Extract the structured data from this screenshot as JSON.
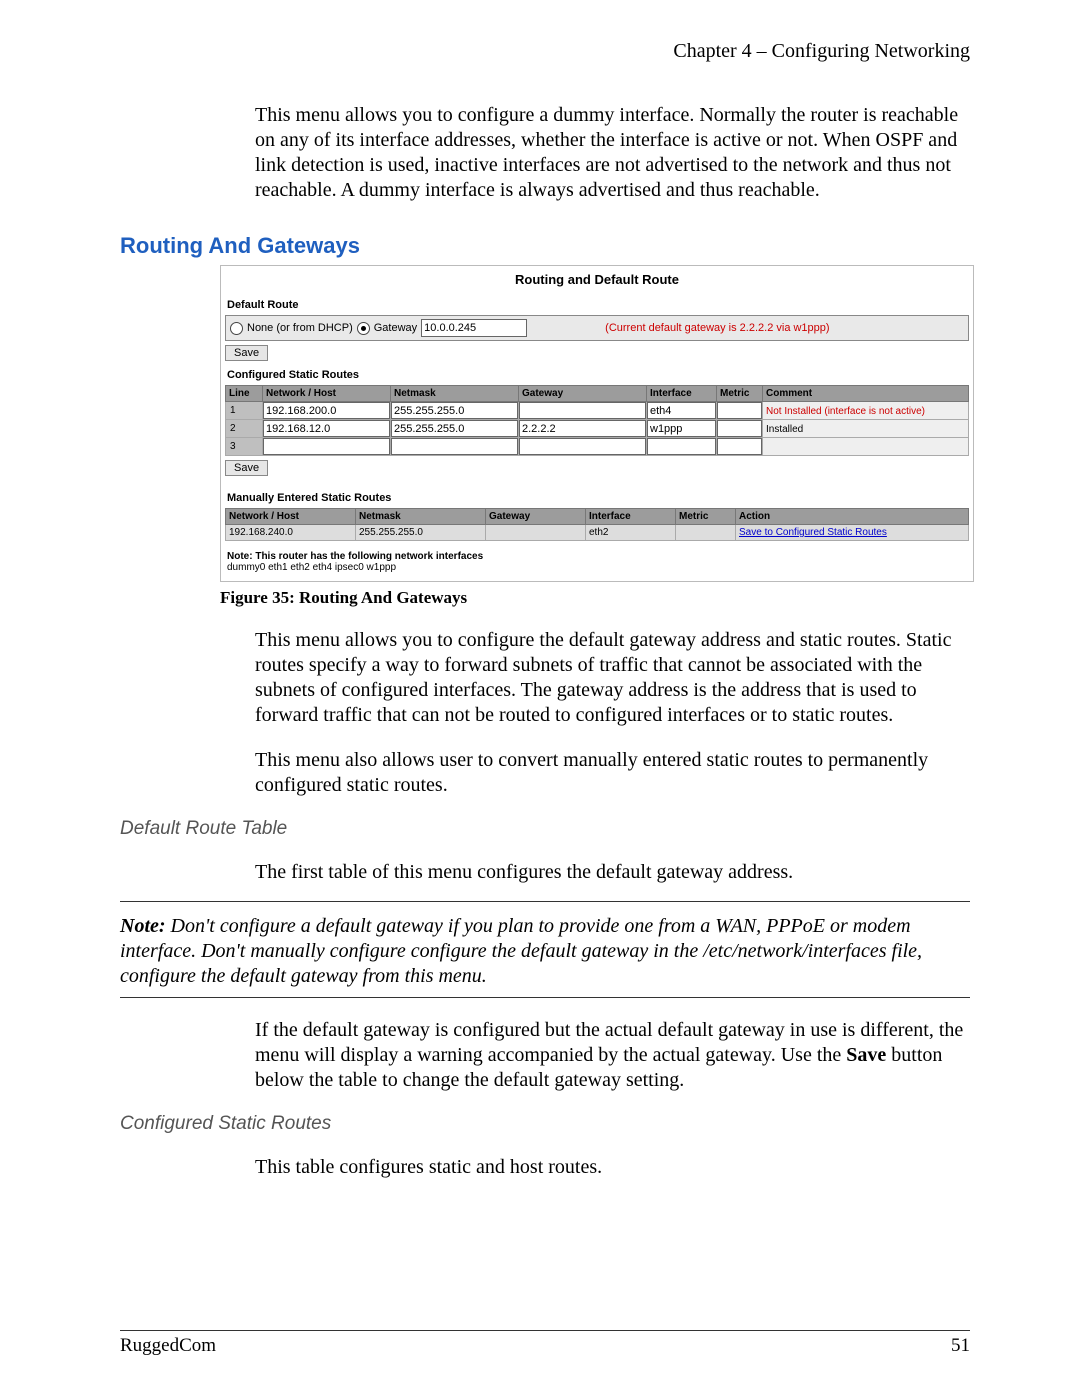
{
  "header": {
    "chapter": "Chapter 4 – Configuring Networking"
  },
  "intro_para": "This menu allows you to configure a dummy interface.  Normally the router is reachable on any of its interface addresses, whether the interface is active or not.  When OSPF and link detection is used, inactive interfaces are not advertised to the network and thus not reachable.  A dummy interface is always advertised and thus reachable.",
  "section_title": "Routing And Gateways",
  "panel": {
    "title": "Routing and Default Route",
    "default_route_label": "Default Route",
    "radio_none_label": "None (or from DHCP)",
    "radio_gateway_label": "Gateway",
    "gateway_value": "10.0.0.245",
    "current_default_text": "(Current default gateway is 2.2.2.2 via w1ppp)",
    "save_label": "Save",
    "configured_label": "Configured Static Routes",
    "cols": {
      "line": "Line",
      "network": "Network / Host",
      "netmask": "Netmask",
      "gateway": "Gateway",
      "interface": "Interface",
      "metric": "Metric",
      "comment": "Comment"
    },
    "rows": [
      {
        "line": "1",
        "network": "192.168.200.0",
        "netmask": "255.255.255.0",
        "gateway": "",
        "interface": "eth4",
        "metric": "",
        "comment": "Not Installed (interface is not active)",
        "comment_red": true
      },
      {
        "line": "2",
        "network": "192.168.12.0",
        "netmask": "255.255.255.0",
        "gateway": "2.2.2.2",
        "interface": "w1ppp",
        "metric": "",
        "comment": "Installed",
        "comment_red": false
      },
      {
        "line": "3",
        "network": "",
        "netmask": "",
        "gateway": "",
        "interface": "",
        "metric": "",
        "comment": "",
        "comment_red": false
      }
    ],
    "save2_label": "Save",
    "manual_label": "Manually Entered Static Routes",
    "mcols": {
      "network": "Network / Host",
      "netmask": "Netmask",
      "gateway": "Gateway",
      "interface": "Interface",
      "metric": "Metric",
      "action": "Action"
    },
    "mrow": {
      "network": "192.168.240.0",
      "netmask": "255.255.255.0",
      "gateway": "",
      "interface": "eth2",
      "metric": "",
      "action": "Save to Configured Static Routes"
    },
    "note_bold": "Note: This router has the following network interfaces",
    "iface_list": "dummy0 eth1 eth2 eth4 ipsec0 w1ppp"
  },
  "figure_caption": "Figure 35: Routing And Gateways",
  "after_para1": "This menu allows you to configure the default gateway address and static routes.  Static routes specify a way to forward subnets of traffic that cannot be associated with the subnets of configured interfaces.  The gateway address is the address that is used to forward traffic that can not be routed to configured interfaces or to static routes.",
  "after_para2": "This menu also allows user to convert manually entered static routes to permanently configured static routes.",
  "sub1_title": "Default Route Table",
  "sub1_text": "The first table of this menu configures the default gateway address.",
  "note_block": {
    "lead": "Note:",
    "body": "  Don't configure a default gateway if you plan to provide one from a WAN, PPPoE or modem interface.  Don't manually configure configure the default gateway in the /etc/network/interfaces file, configure the default gateway from this menu."
  },
  "sub1_after": {
    "t1": "If the default gateway is configured but the actual default gateway in use is different, the menu will display a warning accompanied by the actual gateway.  Use the ",
    "bold": "Save",
    "t2": " button below the table to change the default gateway setting."
  },
  "sub2_title": "Configured Static Routes",
  "sub2_text": "This table configures static and host routes.",
  "footer": {
    "left": "RuggedCom",
    "right": "51"
  }
}
